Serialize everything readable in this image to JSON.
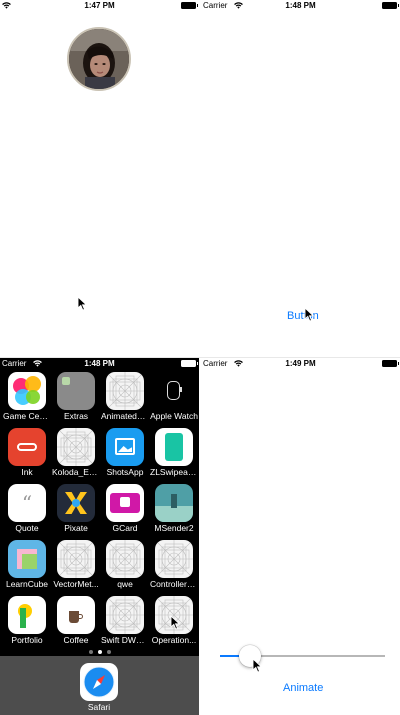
{
  "screens": {
    "top_left": {
      "carrier": "",
      "time": "1:47 PM"
    },
    "top_right": {
      "carrier": "Carrier",
      "time": "1:48 PM",
      "button_label": "Button"
    },
    "bottom_left": {
      "carrier": "Carrier",
      "time": "1:48 PM",
      "apps": [
        {
          "label": "Game Center",
          "icon": "game-center-icon"
        },
        {
          "label": "Extras",
          "icon": "extras-folder-icon"
        },
        {
          "label": "AnimatedC...",
          "icon": "placeholder-app-icon"
        },
        {
          "label": "Apple Watch",
          "icon": "apple-watch-icon"
        },
        {
          "label": "Ink",
          "icon": "ink-app-icon"
        },
        {
          "label": "Koloda_Ex...",
          "icon": "placeholder-app-icon"
        },
        {
          "label": "ShotsApp",
          "icon": "shotsapp-icon"
        },
        {
          "label": "ZLSwipeab...",
          "icon": "zlswipeable-icon"
        },
        {
          "label": "Quote",
          "icon": "quote-icon"
        },
        {
          "label": "Pixate",
          "icon": "pixate-icon"
        },
        {
          "label": "GCard",
          "icon": "gcard-icon"
        },
        {
          "label": "MSender2",
          "icon": "msender-icon"
        },
        {
          "label": "LearnCube",
          "icon": "learncube-icon"
        },
        {
          "label": "VectorMet...",
          "icon": "placeholder-app-icon"
        },
        {
          "label": "qwe",
          "icon": "placeholder-app-icon"
        },
        {
          "label": "ControllerT...",
          "icon": "placeholder-app-icon"
        },
        {
          "label": "Portfolio",
          "icon": "portfolio-icon"
        },
        {
          "label": "Coffee",
          "icon": "coffee-icon"
        },
        {
          "label": "Swift DWC - 1",
          "icon": "placeholder-app-icon"
        },
        {
          "label": "Operation...",
          "icon": "placeholder-app-icon"
        }
      ],
      "page_dots": {
        "count": 3,
        "current": 2
      },
      "dock": [
        {
          "label": "Safari",
          "icon": "safari-icon"
        }
      ]
    },
    "bottom_right": {
      "carrier": "Carrier",
      "time": "1:49 PM",
      "slider_value": 0.18,
      "button_label": "Animate"
    }
  },
  "colors": {
    "accent": "#0a7aff",
    "dock": "#4d4d4d"
  }
}
